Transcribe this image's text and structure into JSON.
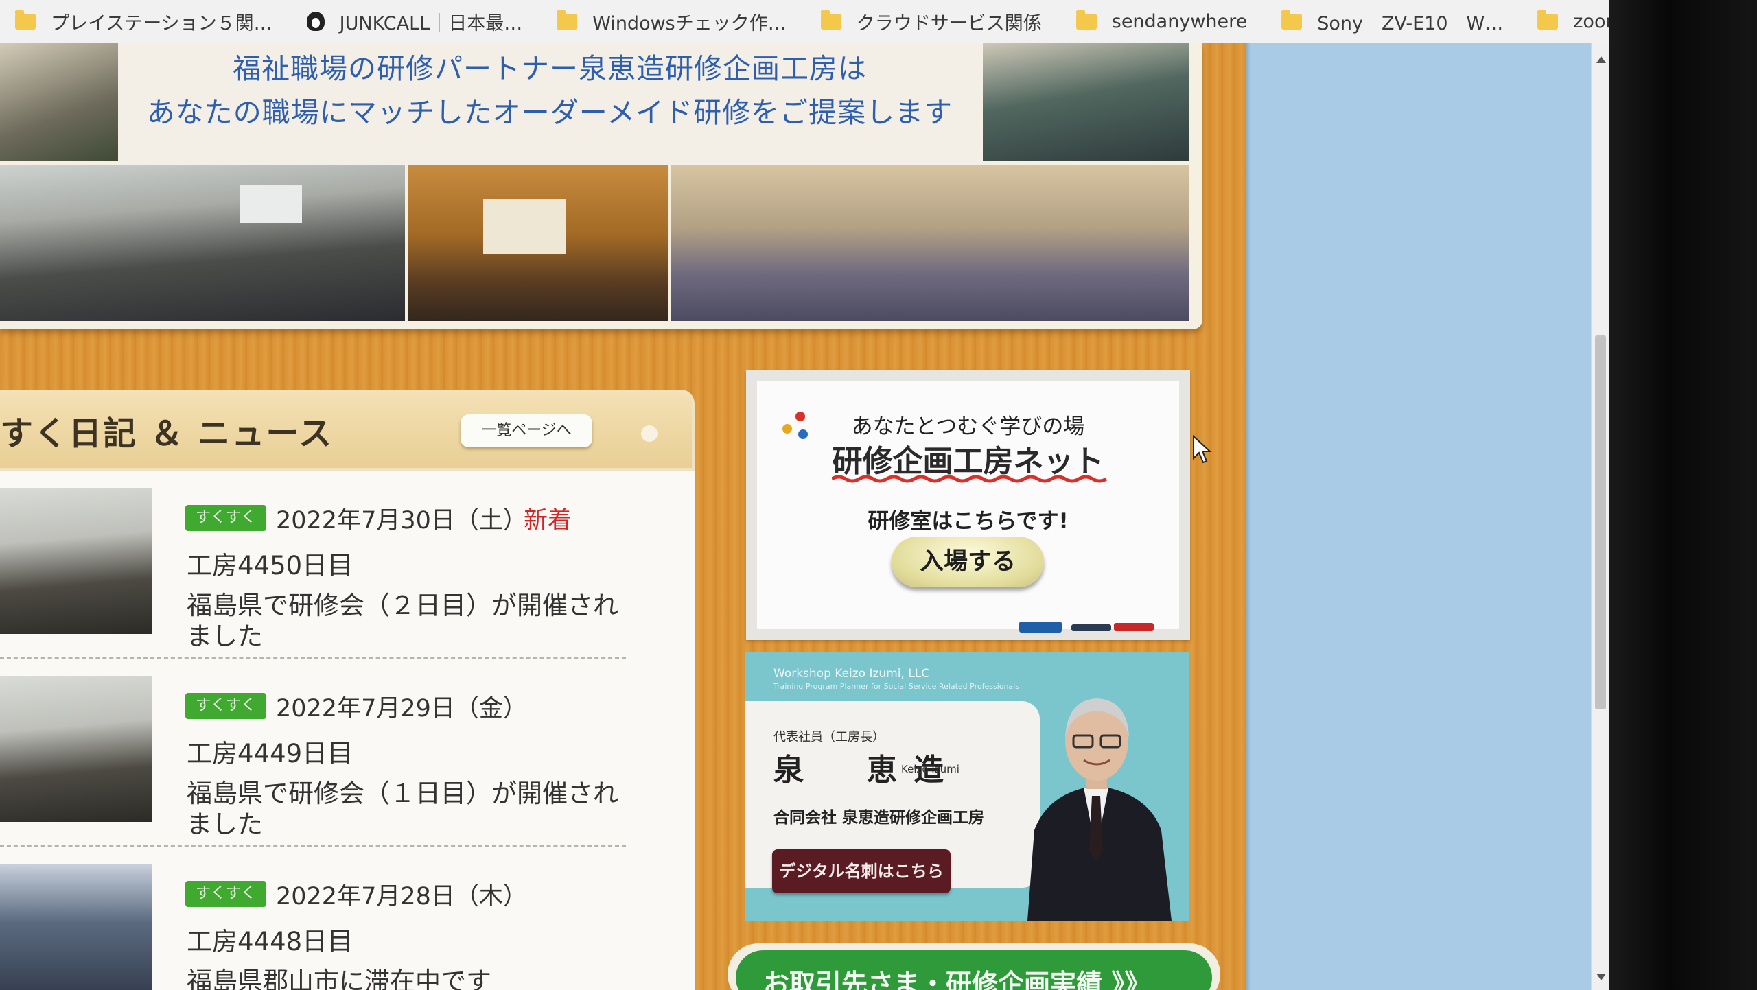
{
  "bookmarks": {
    "items": [
      {
        "label": "プレイステーション５関…",
        "icon": "folder-icon"
      },
      {
        "label": "JUNKCALL｜日本最…",
        "icon": "penguin-icon"
      },
      {
        "label": "Windowsチェック作…",
        "icon": "folder-icon"
      },
      {
        "label": "クラウドサービス関係",
        "icon": "folder-icon"
      },
      {
        "label": "sendanywhere",
        "icon": "folder-icon"
      },
      {
        "label": "Sony　ZV-E10　W…",
        "icon": "folder-icon"
      },
      {
        "label": "zoom",
        "icon": "folder-icon"
      }
    ],
    "more": "»"
  },
  "hero": {
    "line1": "福祉職場の研修パートナー泉恵造研修企画工房は",
    "line2": "あなたの職場にマッチしたオーダーメイド研修をご提案します"
  },
  "news": {
    "title": "すく日記 ＆ ニュース",
    "list_button": "一覧ページへ",
    "items": [
      {
        "tag": "すくすく",
        "date": "2022年7月30日（土）",
        "new_label": "新着",
        "day": "工房4450日目",
        "desc": "福島県で研修会（２日目）が開催されました"
      },
      {
        "tag": "すくすく",
        "date": "2022年7月29日（金）",
        "new_label": "",
        "day": "工房4449日目",
        "desc": "福島県で研修会（１日目）が開催されました"
      },
      {
        "tag": "すくすく",
        "date": "2022年7月28日（木）",
        "new_label": "",
        "day": "工房4448日目",
        "desc": "福島県郡山市に滞在中です"
      }
    ]
  },
  "training_room": {
    "subtitle": "あなたとつむぐ学びの場",
    "title": "研修企画工房ネット",
    "here": "研修室はこちらです!",
    "enter_button": "入場する",
    "colors": {
      "dot1": "#d9302b",
      "dot2": "#e8a91f",
      "dot3": "#2a6cc0",
      "wave": "#d9302b"
    }
  },
  "profile": {
    "brand": "Workshop Keizo Izumi, LLC",
    "brand_sub": "Training Program Planner for Social Service Related Professionals",
    "role": "代表社員（工房長）",
    "name": "泉　恵造",
    "name_roman": "Keizo Izumi",
    "company": "合同会社 泉恵造研修企画工房",
    "card_button": "デジタル名刺はこちら"
  },
  "banner": {
    "text": "お取引先さま・研修企画実績 》》"
  }
}
